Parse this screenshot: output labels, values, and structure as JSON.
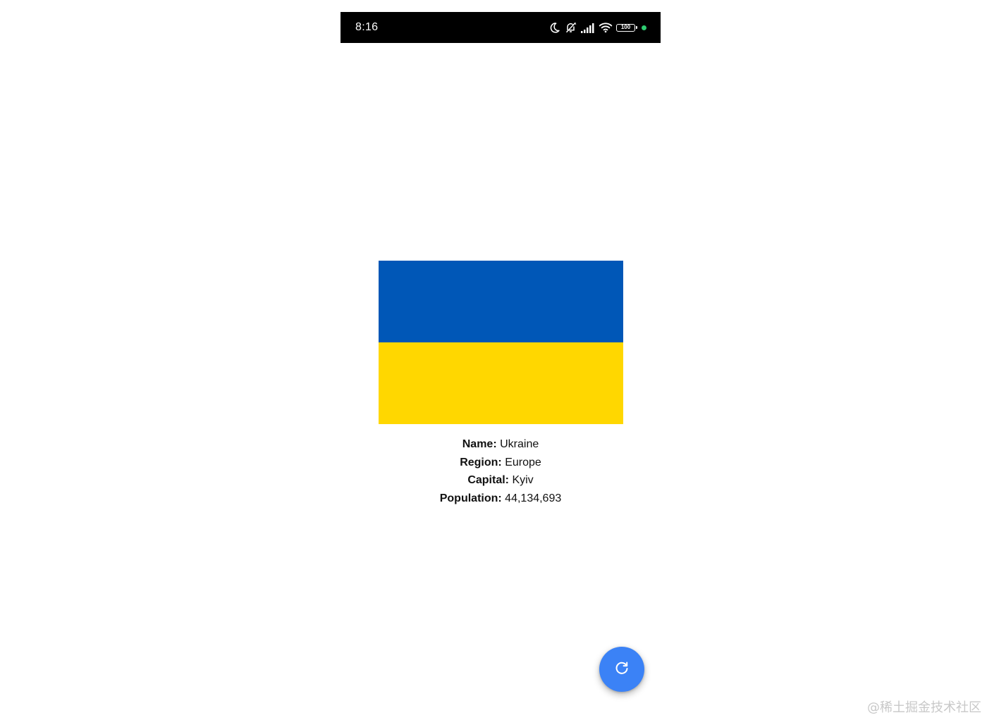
{
  "status_bar": {
    "time": "8:16",
    "icons": [
      "moon-icon",
      "bell-off-icon",
      "signal-icon",
      "wifi-icon",
      "battery-icon"
    ],
    "battery_level": "100",
    "indicator_color": "#2ecc71"
  },
  "flag": {
    "top_color": "#0057b7",
    "bottom_color": "#ffd700"
  },
  "country": {
    "name_label": "Name:",
    "name": "Ukraine",
    "region_label": "Region:",
    "region": "Europe",
    "capital_label": "Capital:",
    "capital": "Kyiv",
    "population_label": "Population:",
    "population": "44,134,693"
  },
  "fab": {
    "icon": "refresh-icon",
    "color": "#3b82f6"
  },
  "watermark": "@稀土掘金技术社区"
}
